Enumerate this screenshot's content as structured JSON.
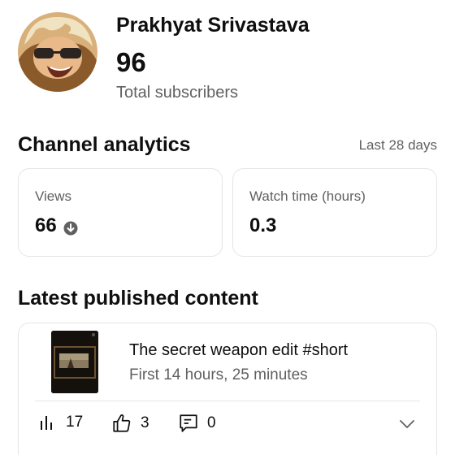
{
  "channel": {
    "name": "Prakhyat Srivastava",
    "subscriber_count": "96",
    "subscriber_label": "Total subscribers"
  },
  "analytics": {
    "title": "Channel analytics",
    "period": "Last 28 days",
    "views": {
      "label": "Views",
      "value": "66",
      "trend": "down"
    },
    "watch_time": {
      "label": "Watch time (hours)",
      "value": "0.3"
    }
  },
  "latest": {
    "title": "Latest published content",
    "video": {
      "title": "The secret weapon edit #short",
      "subtitle": "First 14 hours, 25 minutes",
      "views": "17",
      "likes": "3",
      "comments": "0"
    }
  },
  "colors": {
    "text_primary": "#0f0f0f",
    "text_secondary": "#606060",
    "card_border": "#e5e5e5"
  },
  "icons": [
    "down-arrow-circle-icon",
    "bar-chart-icon",
    "thumbs-up-icon",
    "comment-icon",
    "chevron-down-icon"
  ]
}
